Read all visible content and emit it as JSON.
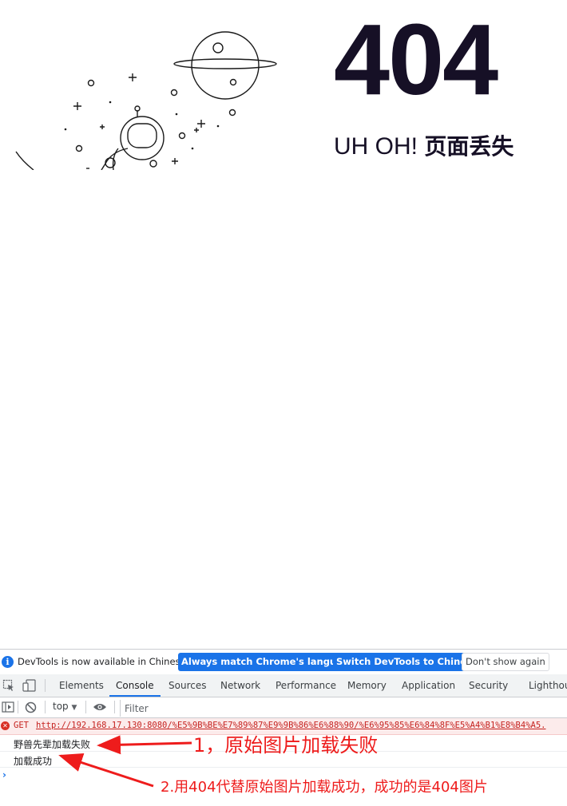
{
  "page": {
    "big_code": "404",
    "subtitle_en": "UH OH!",
    "subtitle_cn": "页面丢失"
  },
  "devtools": {
    "infobar": {
      "text": "DevTools is now available in Chinese!",
      "btn_match": "Always match Chrome's language",
      "btn_switch": "Switch DevTools to Chinese",
      "btn_dismiss": "Don't show again"
    },
    "tabs": [
      "Elements",
      "Console",
      "Sources",
      "Network",
      "Performance",
      "Memory",
      "Application",
      "Security",
      "Lighthou"
    ],
    "active_tab": "Console",
    "toolbar": {
      "context": "top",
      "filter_placeholder": "Filter"
    },
    "console": {
      "error_method": "GET",
      "error_url": "http://192.168.17.130:8080/%E5%9B%BE%E7%89%87%E9%9B%86%E6%88%90/%E6%95%85%E6%84%8F%E5%A4%B1%E8%B4%A5.",
      "log_1": "野兽先辈加载失败",
      "log_2": "加载成功"
    }
  },
  "annotations": {
    "note_1": "1，原始图片加载失败",
    "note_2": "2.用404代替原始图片加载成功，成功的是404图片",
    "color": "#ee1c1c"
  }
}
